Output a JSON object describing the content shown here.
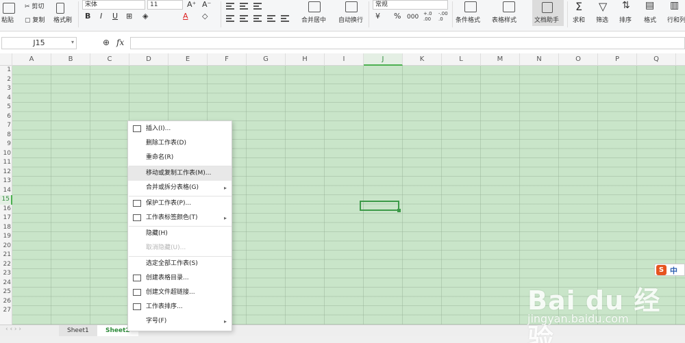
{
  "ribbon": {
    "paste": "粘贴",
    "cut": "剪切",
    "copy": "复制",
    "format_painter": "格式刷",
    "font_name": "宋体",
    "font_size": "11",
    "bold": "B",
    "italic": "I",
    "underline": "U",
    "font_color_glyph": "A",
    "merge_center": "合并居中",
    "wrap_text": "自动换行",
    "number_format": "常规",
    "percent": "%",
    "thousands": "000",
    "dec_inc": "+.0 .00",
    "dec_dec": "-.00 .0",
    "conditional_format": "条件格式",
    "table_style": "表格样式",
    "doc_assistant": "文档助手",
    "sum": "求和",
    "filter": "筛选",
    "sort": "排序",
    "format": "格式",
    "row_col": "行和列",
    "grow_font_glyph": "A⁺",
    "shrink_font_glyph": "A⁻"
  },
  "formula_bar": {
    "cell_ref": "J15",
    "fx_label": "fx",
    "value": ""
  },
  "grid": {
    "columns": [
      "A",
      "B",
      "C",
      "D",
      "E",
      "F",
      "G",
      "H",
      "I",
      "J",
      "K",
      "L",
      "M",
      "N",
      "O",
      "P",
      "Q"
    ],
    "selected_column": "J",
    "rows": [
      "1",
      "2",
      "3",
      "4",
      "5",
      "6",
      "7",
      "8",
      "9",
      "10",
      "11",
      "12",
      "13",
      "14",
      "15",
      "16",
      "17",
      "18",
      "19",
      "20",
      "21",
      "22",
      "23",
      "24",
      "25",
      "26",
      "27"
    ],
    "selected_row": "15"
  },
  "sheet_tabs": [
    "Sheet1",
    "Sheet2"
  ],
  "active_sheet": "Sheet2",
  "context_menu": {
    "items": [
      {
        "label": "插入(I)...",
        "icon": "insert-icon"
      },
      {
        "label": "删除工作表(D)"
      },
      {
        "label": "重命名(R)"
      },
      {
        "label": "移动或复制工作表(M)...",
        "highlighted": true
      },
      {
        "label": "合并或拆分表格(G)",
        "submenu": true
      },
      {
        "label": "保护工作表(P)...",
        "icon": "protect-sheet-icon"
      },
      {
        "label": "工作表标签颜色(T)",
        "icon": "tab-color-icon",
        "submenu": true
      },
      {
        "label": "隐藏(H)"
      },
      {
        "label": "取消隐藏(U)...",
        "disabled": true
      },
      {
        "label": "选定全部工作表(S)"
      },
      {
        "label": "创建表格目录...",
        "icon": "table-directory-icon"
      },
      {
        "label": "创建文件超链接...",
        "icon": "hyperlink-icon"
      },
      {
        "label": "工作表排序...",
        "icon": "sheet-sort-icon"
      },
      {
        "label": "字号(F)",
        "submenu": true
      }
    ],
    "submenu_arrow": "▸"
  },
  "ime": {
    "logo": "S",
    "lang": "中"
  },
  "watermark": {
    "brand": "Bai du 经验",
    "url": "jingyan.baidu.com"
  },
  "colors": {
    "grid_bg": "#c9e5c9",
    "accent": "#3c9a48"
  }
}
